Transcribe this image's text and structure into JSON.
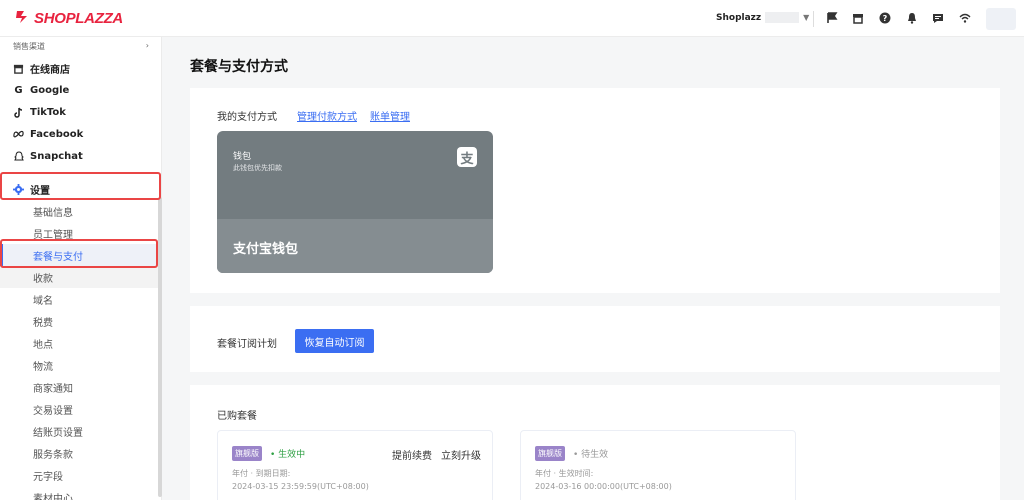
{
  "header": {
    "brand": "SHOPLAZZA",
    "store_name": "Shoplazz",
    "icons": [
      "flag-icon",
      "store-icon",
      "help-icon",
      "bell-icon",
      "message-icon",
      "wifi-icon"
    ]
  },
  "sidebar": {
    "section_label": "销售渠道",
    "channels": [
      {
        "label": "在线商店",
        "icon": "store-icon"
      },
      {
        "label": "Google",
        "icon": "google-icon"
      },
      {
        "label": "TikTok",
        "icon": "tiktok-icon"
      },
      {
        "label": "Facebook",
        "icon": "meta-icon"
      },
      {
        "label": "Snapchat",
        "icon": "snapchat-icon"
      }
    ],
    "settings_label": "设置",
    "settings_items": [
      "基础信息",
      "员工管理",
      "套餐与支付",
      "收款",
      "域名",
      "税费",
      "地点",
      "物流",
      "商家通知",
      "交易设置",
      "结账页设置",
      "服务条款",
      "元字段",
      "素材中心"
    ],
    "active_item": "套餐与支付"
  },
  "page": {
    "title": "套餐与支付方式",
    "payment": {
      "label": "我的支付方式",
      "manage_link": "管理付款方式",
      "bill_link": "账单管理",
      "wallet_title": "钱包",
      "wallet_subtitle": "此钱包优先扣款",
      "wallet_name": "支付宝钱包",
      "wallet_glyph": "支"
    },
    "subscription": {
      "label": "套餐订阅计划",
      "button": "恢复自动订阅"
    },
    "purchased": {
      "label": "已购套餐",
      "plans": [
        {
          "badge": "旗舰版",
          "status": "• 生效中",
          "line1": "年付 · 到期日期:",
          "line2": "2024-03-15 23:59:59(UTC+08:00)",
          "actions": [
            "提前续费",
            "立刻升级"
          ]
        },
        {
          "badge": "旗舰版",
          "status": "• 待生效",
          "line1": "年付 · 生效时间:",
          "line2": "2024-03-16 00:00:00(UTC+08:00)",
          "actions": []
        }
      ]
    }
  },
  "colors": {
    "brand": "#e8233f",
    "accent": "#3b6ef2",
    "highlight": "#ea4545",
    "badge": "#9a84c9",
    "active_status": "#2ea043"
  }
}
